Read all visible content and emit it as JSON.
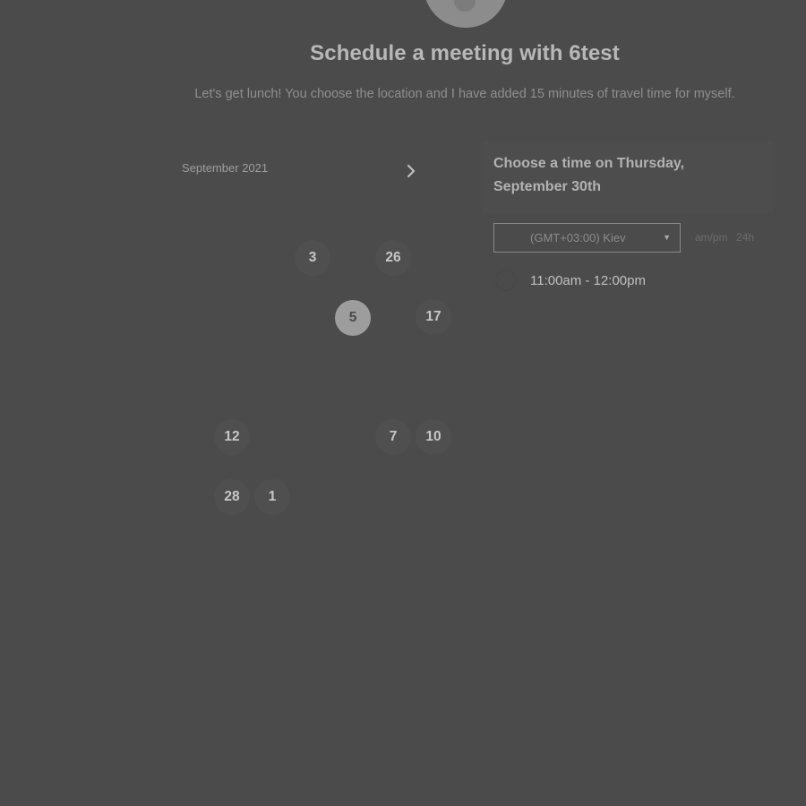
{
  "header": {
    "title": "Schedule a meeting with 6test",
    "description": "Let's get lunch! You choose the location and I have added 15 minutes of travel time for myself."
  },
  "calendar": {
    "month_label": "September 2021",
    "next_month_icon": "chevron-right-icon",
    "weekdays": [
      "",
      "",
      "",
      "",
      "",
      "",
      ""
    ],
    "days": [
      {
        "label": "3"
      },
      {
        "label": "26"
      },
      {
        "label": "5",
        "selected": true
      },
      {
        "label": "17"
      },
      {
        "label": "12"
      },
      {
        "label": "7"
      },
      {
        "label": "10"
      },
      {
        "label": "28"
      },
      {
        "label": "1"
      }
    ]
  },
  "time_panel": {
    "heading": "Choose a time on Thursday, September 30th",
    "timezone": {
      "value": "(GMT+03:00) Kiev",
      "caret_icon": "caret-down-icon"
    },
    "format_options": [
      "am/pm",
      "24h"
    ],
    "slots": [
      {
        "label": "11:00am - 12:00pm"
      }
    ]
  },
  "colors": {
    "background": "#4b4b4b",
    "selected_day": "#9d9d9d",
    "text": "#c7c7c7"
  }
}
